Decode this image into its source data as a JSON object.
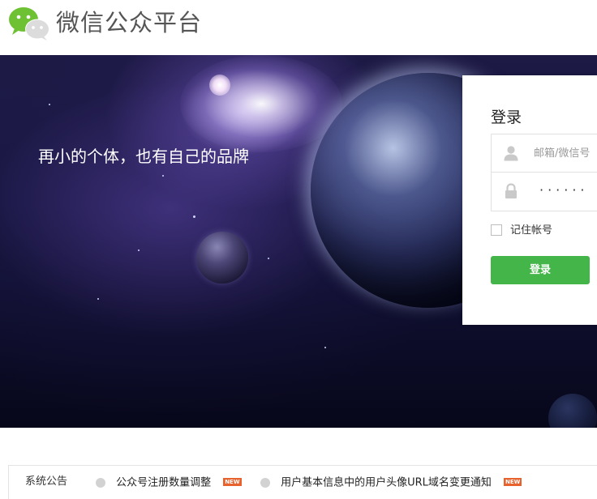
{
  "header": {
    "logo_icon": "wechat-logo-icon",
    "title": "微信公众平台"
  },
  "banner": {
    "slogan": "再小的个体，也有自己的品牌"
  },
  "login": {
    "title": "登录",
    "username_icon": "user-icon",
    "username_placeholder": "邮箱/微信号",
    "password_icon": "lock-icon",
    "password_masked": "······",
    "remember_label": "记住帐号",
    "remember_checked": false,
    "submit_label": "登录",
    "accent_color": "#44b549"
  },
  "notices": {
    "title": "系统公告",
    "items": [
      {
        "text": "公众号注册数量调整",
        "badge": "NEW"
      },
      {
        "text": "用户基本信息中的用户头像URL域名变更通知",
        "badge": "NEW"
      }
    ],
    "badge_color": "#e8622d"
  }
}
